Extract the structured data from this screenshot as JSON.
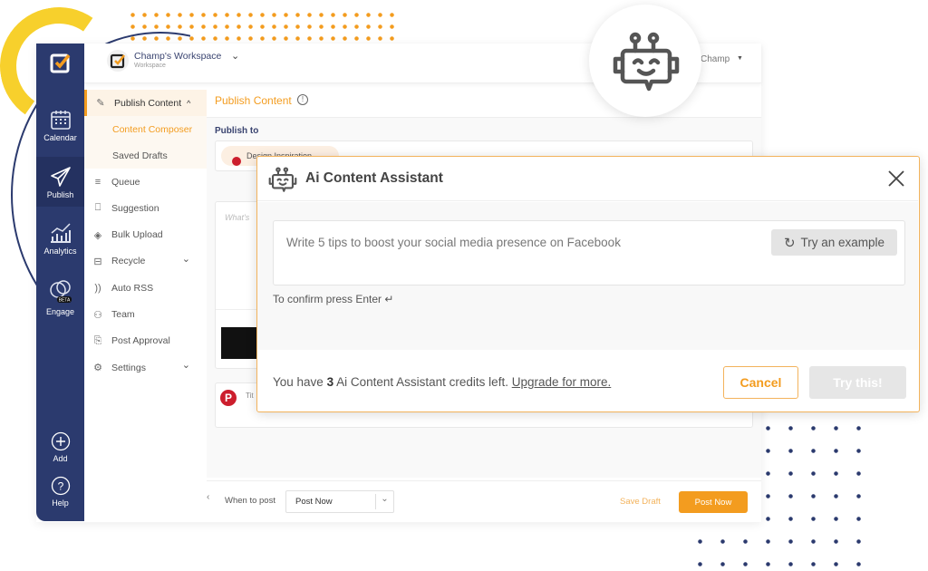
{
  "colors": {
    "navy": "#2b3a6e",
    "accent": "#f39c1f",
    "modal_border": "#f3b35c"
  },
  "rail": {
    "items": [
      {
        "label": "Calendar",
        "icon": "calendar-icon"
      },
      {
        "label": "Publish",
        "icon": "paper-plane-icon",
        "active": true
      },
      {
        "label": "Analytics",
        "icon": "analytics-icon"
      },
      {
        "label": "Engage",
        "icon": "chat-bubbles-icon",
        "badge": "BETA"
      },
      {
        "label": "Add",
        "icon": "plus-circle-icon"
      },
      {
        "label": "Help",
        "icon": "help-circle-icon"
      }
    ]
  },
  "header": {
    "workspace_name": "Champ's Workspace",
    "workspace_sub": "Workspace",
    "user": "Champ"
  },
  "submenu": {
    "section": "Publish Content",
    "sub_items": [
      "Content Composer",
      "Saved Drafts"
    ],
    "items": [
      {
        "label": "Queue",
        "icon": "list-icon"
      },
      {
        "label": "Suggestion",
        "icon": "bookmark-icon"
      },
      {
        "label": "Bulk Upload",
        "icon": "layers-icon"
      },
      {
        "label": "Recycle",
        "icon": "archive-icon",
        "has_chevron": true
      },
      {
        "label": "Auto RSS",
        "icon": "rss-icon"
      },
      {
        "label": "Team",
        "icon": "user-icon"
      },
      {
        "label": "Post Approval",
        "icon": "scroll-icon"
      },
      {
        "label": "Settings",
        "icon": "gear-icon",
        "has_chevron": true
      }
    ]
  },
  "main": {
    "title": "Publish Content",
    "publish_to": "Publish to",
    "account_chip": "Design Inspiration",
    "composer_placeholder": "What's",
    "title_placeholder": "Tit"
  },
  "footer": {
    "when_label": "When to post",
    "when_value": "Post Now",
    "save_draft": "Save Draft",
    "post_now": "Post Now"
  },
  "modal": {
    "title": "Ai Content Assistant",
    "prompt_placeholder": "Write 5 tips to boost your social media presence on Facebook",
    "try_example": "Try an example",
    "confirm_hint": "To confirm press Enter",
    "credits_prefix": "You have",
    "credits_count": "3",
    "credits_suffix": "Ai Content Assistant credits left.",
    "upgrade_link": "Upgrade for more.",
    "cancel": "Cancel",
    "try_this": "Try this!"
  }
}
